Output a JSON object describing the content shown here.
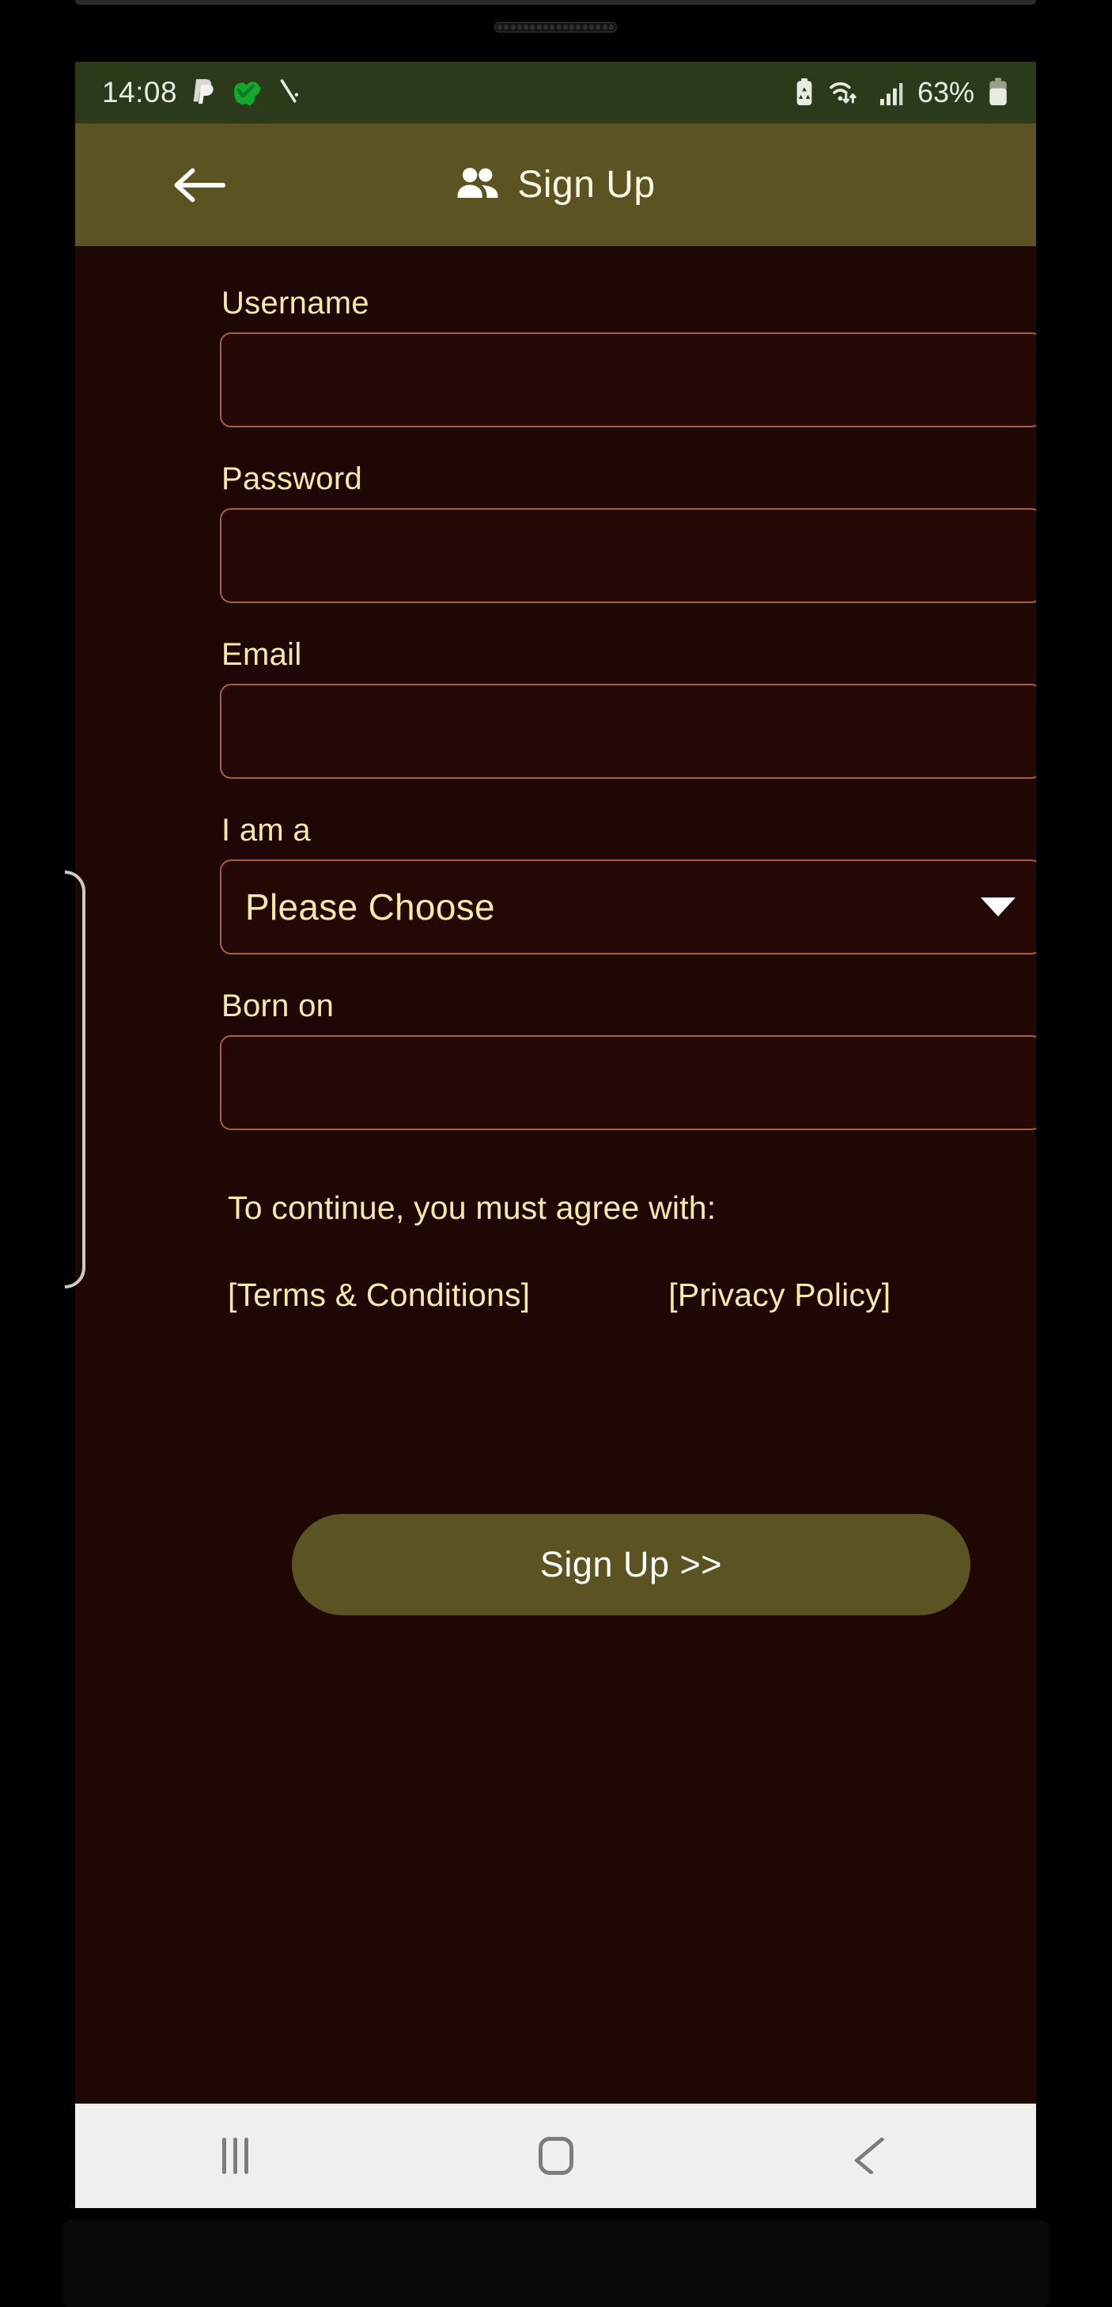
{
  "status_bar": {
    "time": "14:08",
    "left_icons": [
      "paypal-icon",
      "australia-map-icon",
      "pen-slash-icon"
    ],
    "right_icons": [
      "battery-recycle-icon",
      "wifi-transfer-icon",
      "cellular-signal-icon"
    ],
    "battery_percent": "63%",
    "background_color": "#2c3a1c",
    "text_color": "#e8ece0"
  },
  "app_bar": {
    "back_icon": "back-arrow-icon",
    "title_icon": "people-icon",
    "title": "Sign Up",
    "background_color": "#5b5321",
    "text_color": "#fbf7e6"
  },
  "form": {
    "fields": [
      {
        "label": "Username",
        "value": "",
        "placeholder": "",
        "type": "text"
      },
      {
        "label": "Password",
        "value": "",
        "placeholder": "",
        "type": "password"
      },
      {
        "label": "Email",
        "value": "",
        "placeholder": "",
        "type": "email"
      },
      {
        "label": "I am a",
        "value": "Please Choose",
        "placeholder": "",
        "type": "select"
      },
      {
        "label": "Born on",
        "value": "",
        "placeholder": "",
        "type": "date"
      }
    ],
    "select_caret_icon": "chevron-down-icon",
    "label_color": "#f7e9a8",
    "input_border_color": "#a8603a",
    "input_background": "#230806"
  },
  "agreement": {
    "text": "To continue, you must agree with:",
    "links": [
      {
        "label": "[Terms & Conditions]"
      },
      {
        "label": "[Privacy Policy]"
      }
    ]
  },
  "primary_action": {
    "label": "Sign Up >>",
    "background_color": "#5b5321",
    "text_color": "#ffffff"
  },
  "nav_bar": {
    "buttons": [
      {
        "name": "recents",
        "icon": "recents-icon"
      },
      {
        "name": "home",
        "icon": "home-icon"
      },
      {
        "name": "back",
        "icon": "back-chevron-icon"
      }
    ],
    "background_color": "#f0efed",
    "icon_color": "#7c7c7c"
  },
  "theme": {
    "page_background": "#1e0705",
    "accent": "#5b5321"
  }
}
